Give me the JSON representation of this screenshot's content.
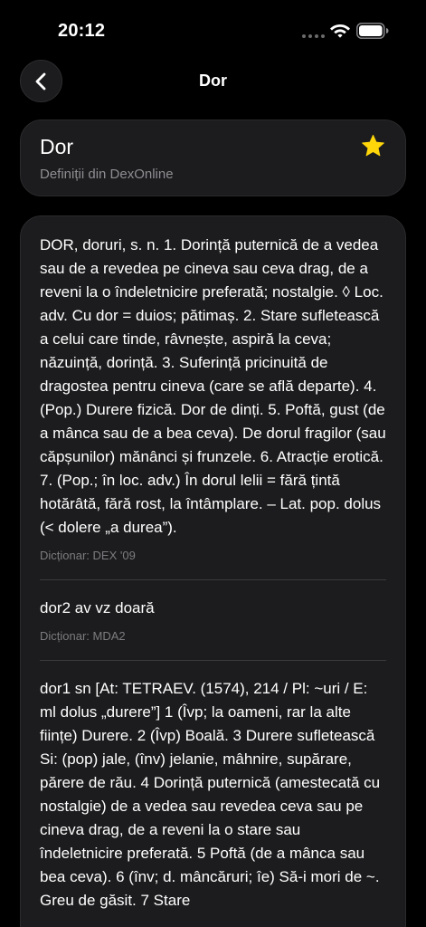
{
  "status_bar": {
    "time": "20:12"
  },
  "nav": {
    "title": "Dor"
  },
  "header": {
    "word": "Dor",
    "subtitle": "Definiții din DexOnline",
    "star_color": "#FFD60A"
  },
  "definitions": [
    {
      "text": "DOR, doruri, s. n. 1. Dorință puternică de a vedea sau de a revedea pe cineva sau ceva drag, de a reveni la o îndeletnicire preferată; nostalgie. ◊ Loc. adv. Cu dor = duios; pătimaș. 2. Stare sufletească a celui care tinde, râvnește, aspiră la ceva; năzuință, dorință. 3. Suferință pricinuită de dragostea pentru cineva (care se află departe). 4. (Pop.) Durere fizică. Dor de dinți. 5. Poftă, gust (de a mânca sau de a bea ceva). De dorul fragilor (sau căpșunilor) mănânci și frunzele. 6. Atracție erotică. 7. (Pop.; în loc. adv.) În dorul lelii = fără țintă hotărâtă, fără rost, la întâmplare. – Lat. pop. dolus (< dolere „a durea”).",
      "source": "Dicționar: DEX '09"
    },
    {
      "text": "dor2 av vz doară",
      "source": "Dicționar: MDA2"
    },
    {
      "text": "dor1 sn [At: TETRAEV. (1574), 214 / Pl: ~uri / E: ml dolus „durere”] 1 (Îvp; la oameni, rar la alte ființe) Durere. 2 (Îvp) Boală. 3 Durere sufletească Si: (pop) jale, (înv) jelanie, mâhnire, supărare, părere de rău. 4 Dorință puternică (amestecată cu nostalgie) de a vedea sau revedea ceva sau pe cineva drag, de a reveni la o stare sau îndeletnicire preferată. 5 Poftă (de a mânca sau bea ceva). 6 (înv; d. mâncăruri; îe) Să-i mori de ~. Greu de găsit. 7 Stare",
      "source": ""
    }
  ]
}
